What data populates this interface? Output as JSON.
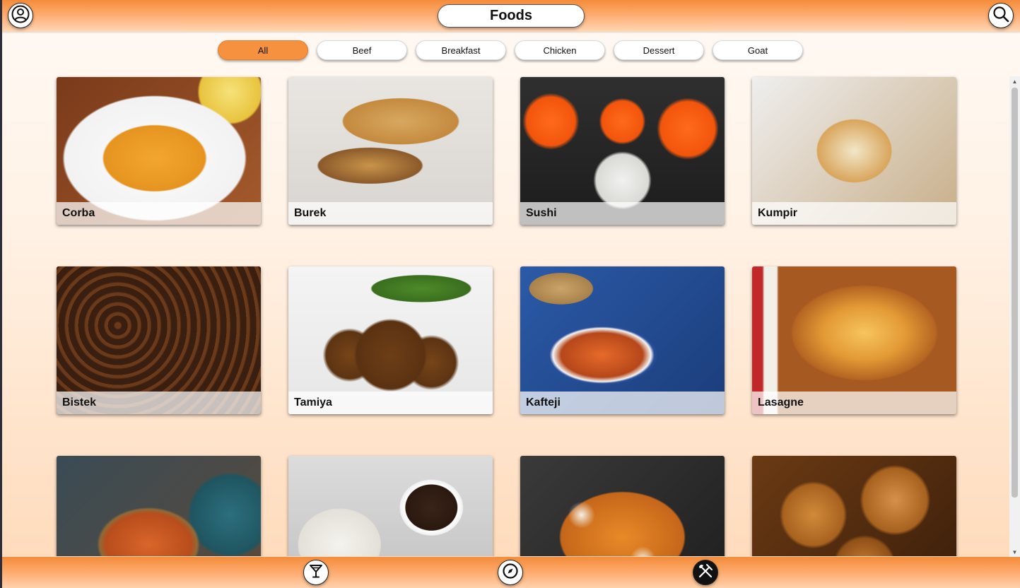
{
  "header": {
    "title": "Foods",
    "profile_icon": "user-circle-icon",
    "search_icon": "search-icon"
  },
  "categories": [
    {
      "label": "All",
      "active": true
    },
    {
      "label": "Beef",
      "active": false
    },
    {
      "label": "Breakfast",
      "active": false
    },
    {
      "label": "Chicken",
      "active": false
    },
    {
      "label": "Dessert",
      "active": false
    },
    {
      "label": "Goat",
      "active": false
    }
  ],
  "foods": [
    {
      "name": "Corba",
      "image": "corba"
    },
    {
      "name": "Burek",
      "image": "burek"
    },
    {
      "name": "Sushi",
      "image": "sushi"
    },
    {
      "name": "Kumpir",
      "image": "kumpir"
    },
    {
      "name": "Bistek",
      "image": "bistek"
    },
    {
      "name": "Tamiya",
      "image": "tamiya"
    },
    {
      "name": "Kafteji",
      "image": "kafteji"
    },
    {
      "name": "Lasagne",
      "image": "lasagne"
    },
    {
      "name": "",
      "image": "soup2"
    },
    {
      "name": "",
      "image": "dumpling"
    },
    {
      "name": "",
      "image": "poutine"
    },
    {
      "name": "",
      "image": "donut"
    }
  ],
  "bottom_nav": [
    {
      "id": "drinks",
      "icon": "cocktail-glass-icon",
      "active": false
    },
    {
      "id": "explore",
      "icon": "compass-icon",
      "active": false
    },
    {
      "id": "foods",
      "icon": "fork-knife-icon",
      "active": true
    }
  ],
  "colors": {
    "accent": "#f5913f",
    "bar_top": "#f48c3a",
    "active_nav": "#111111"
  }
}
